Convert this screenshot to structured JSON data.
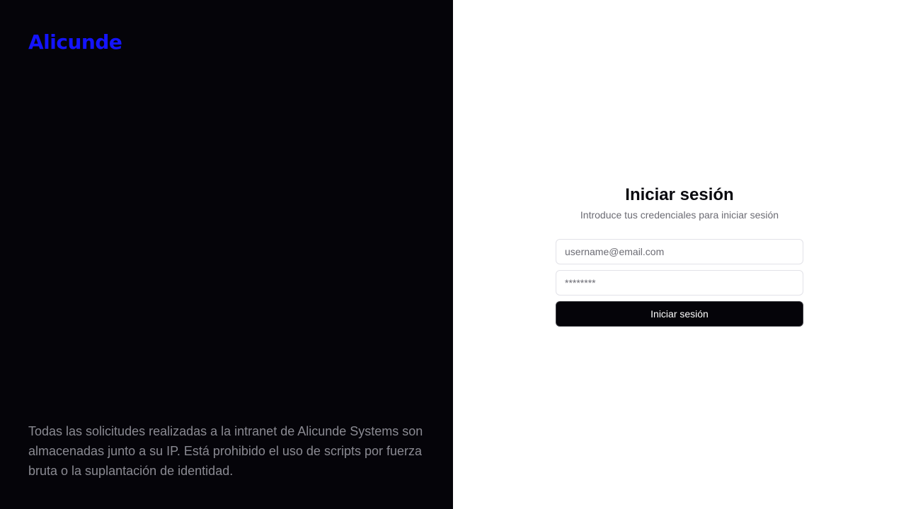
{
  "brand": {
    "logo_text": "Alicunde",
    "logo_color": "#1414ff"
  },
  "left_panel": {
    "disclaimer": "Todas las solicitudes realizadas a la intranet de Alicunde Systems son almacenadas junto a su IP. Está prohibido el uso de scripts por fuerza bruta o la suplantación de identidad."
  },
  "login": {
    "title": "Iniciar sesión",
    "subtitle": "Introduce tus credenciales para iniciar sesión",
    "email_placeholder": "username@email.com",
    "email_value": "",
    "password_placeholder": "********",
    "password_value": "",
    "submit_label": "Iniciar sesión"
  },
  "colors": {
    "left_background": "#050409",
    "right_background": "#ffffff",
    "button_background": "#050409"
  }
}
